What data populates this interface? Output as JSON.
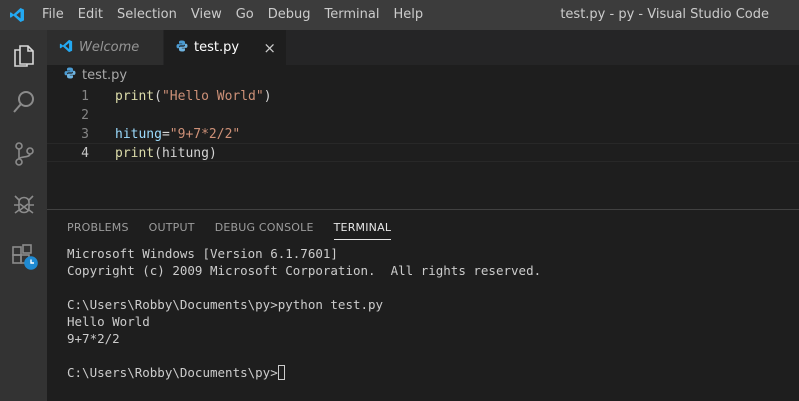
{
  "titlebar": {
    "menu": [
      "File",
      "Edit",
      "Selection",
      "View",
      "Go",
      "Debug",
      "Terminal",
      "Help"
    ],
    "window_title": "test.py - py - Visual Studio Code"
  },
  "activity_bar": {
    "icons": [
      "explorer-icon",
      "search-icon",
      "source-control-icon",
      "debug-icon",
      "extensions-icon"
    ]
  },
  "tabs": [
    {
      "label": "Welcome",
      "icon": "vscode-logo-icon",
      "active": false
    },
    {
      "label": "test.py",
      "icon": "python-icon",
      "active": true,
      "close": "×"
    }
  ],
  "breadcrumb": {
    "file": "test.py"
  },
  "editor": {
    "current_line": 4,
    "lines": [
      {
        "num": "1",
        "tokens": [
          {
            "t": "print",
            "c": "fn"
          },
          {
            "t": "(",
            "c": "plain"
          },
          {
            "t": "\"Hello World\"",
            "c": "str"
          },
          {
            "t": ")",
            "c": "plain"
          }
        ]
      },
      {
        "num": "2",
        "tokens": []
      },
      {
        "num": "3",
        "tokens": [
          {
            "t": "hitung",
            "c": "var"
          },
          {
            "t": "=",
            "c": "plain"
          },
          {
            "t": "\"9+7*2/2\"",
            "c": "str"
          }
        ]
      },
      {
        "num": "4",
        "tokens": [
          {
            "t": "print",
            "c": "fn"
          },
          {
            "t": "(",
            "c": "plain"
          },
          {
            "t": "hitung",
            "c": "var"
          },
          {
            "t": ")",
            "c": "plain"
          }
        ]
      }
    ]
  },
  "panel": {
    "tabs": [
      {
        "label": "PROBLEMS",
        "active": false
      },
      {
        "label": "OUTPUT",
        "active": false
      },
      {
        "label": "DEBUG CONSOLE",
        "active": false
      },
      {
        "label": "TERMINAL",
        "active": true
      }
    ],
    "terminal": {
      "lines": [
        "Microsoft Windows [Version 6.1.7601]",
        "Copyright (c) 2009 Microsoft Corporation.  All rights reserved.",
        "",
        "C:\\Users\\Robby\\Documents\\py>python test.py",
        "Hello World",
        "9+7*2/2",
        ""
      ],
      "prompt": "C:\\Users\\Robby\\Documents\\py>"
    }
  },
  "colors": {
    "titlebar": "#3c3c3c",
    "activitybar": "#333333",
    "editor_bg": "#1e1e1e",
    "vscode_blue": "#23a9f2",
    "python_blue": "#4b9bd2"
  }
}
